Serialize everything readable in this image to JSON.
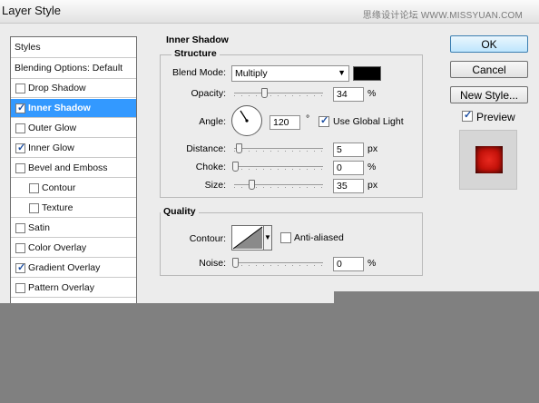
{
  "window": {
    "title": "Layer Style",
    "watermark": "思缘设计论坛  WWW.MISSYUAN.COM"
  },
  "styles_panel": {
    "header": "Styles",
    "blending": "Blending Options: Default",
    "items": [
      {
        "label": "Drop Shadow",
        "checked": false
      },
      {
        "label": "Inner Shadow",
        "checked": true
      },
      {
        "label": "Outer Glow",
        "checked": false
      },
      {
        "label": "Inner Glow",
        "checked": true
      },
      {
        "label": "Bevel and Emboss",
        "checked": false
      },
      {
        "label": "Contour",
        "checked": false
      },
      {
        "label": "Texture",
        "checked": false
      },
      {
        "label": "Satin",
        "checked": false
      },
      {
        "label": "Color Overlay",
        "checked": false
      },
      {
        "label": "Gradient Overlay",
        "checked": true
      },
      {
        "label": "Pattern Overlay",
        "checked": false
      }
    ]
  },
  "inner_shadow": {
    "title": "Inner Shadow",
    "structure": {
      "title": "Structure",
      "blend_mode_label": "Blend Mode:",
      "blend_mode": "Multiply",
      "shadow_color": "#000000",
      "opacity_label": "Opacity:",
      "opacity": "34",
      "opacity_unit": "%",
      "angle_label": "Angle:",
      "angle": "120",
      "angle_unit": "°",
      "global_light_label": "Use Global Light",
      "global_light": true,
      "distance_label": "Distance:",
      "distance": "5",
      "distance_unit": "px",
      "choke_label": "Choke:",
      "choke": "0",
      "choke_unit": "%",
      "size_label": "Size:",
      "size": "35",
      "size_unit": "px"
    },
    "quality": {
      "title": "Quality",
      "contour_label": "Contour:",
      "anti_aliased_label": "Anti-aliased",
      "anti_aliased": false,
      "noise_label": "Noise:",
      "noise": "0",
      "noise_unit": "%"
    }
  },
  "buttons": {
    "ok": "OK",
    "cancel": "Cancel",
    "new_style": "New Style..."
  },
  "preview": {
    "label": "Preview",
    "checked": true
  }
}
